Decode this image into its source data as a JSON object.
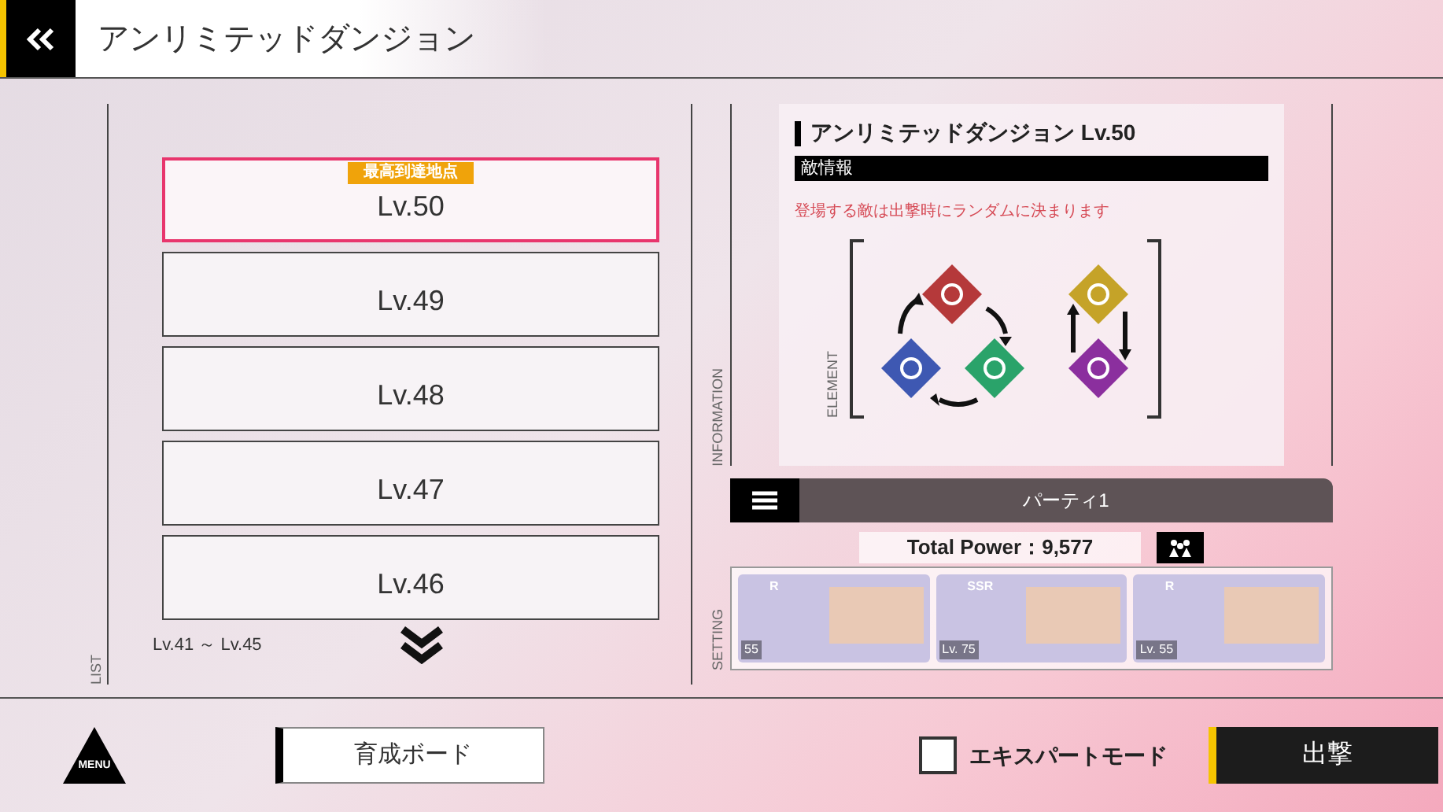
{
  "header": {
    "title": "アンリミテッドダンジョン"
  },
  "list": {
    "label": "LIST",
    "items": [
      {
        "label": "Lv.50",
        "selected": true,
        "badge": "最高到達地点"
      },
      {
        "label": "Lv.49",
        "selected": false
      },
      {
        "label": "Lv.48",
        "selected": false
      },
      {
        "label": "Lv.47",
        "selected": false
      },
      {
        "label": "Lv.46",
        "selected": false
      }
    ],
    "range": "Lv.41 ～ Lv.45"
  },
  "information": {
    "label": "INFORMATION",
    "title": "アンリミテッドダンジョン Lv.50",
    "section": "敵情報",
    "note": "登場する敵は出撃時にランダムに決まります",
    "diagram_label": "ELEMENT"
  },
  "party": {
    "label": "SETTING",
    "name": "パーティ1",
    "total_power": "Total Power：9,577",
    "members": [
      {
        "rarity": "R",
        "level": "55"
      },
      {
        "rarity": "SSR",
        "level": "Lv. 75"
      },
      {
        "rarity": "R",
        "level": "Lv. 55"
      }
    ]
  },
  "footer": {
    "menu": "MENU",
    "board_button": "育成ボード",
    "expert_mode": {
      "label": "エキスパートモード",
      "checked": false
    },
    "sortie_button": "出撃"
  }
}
